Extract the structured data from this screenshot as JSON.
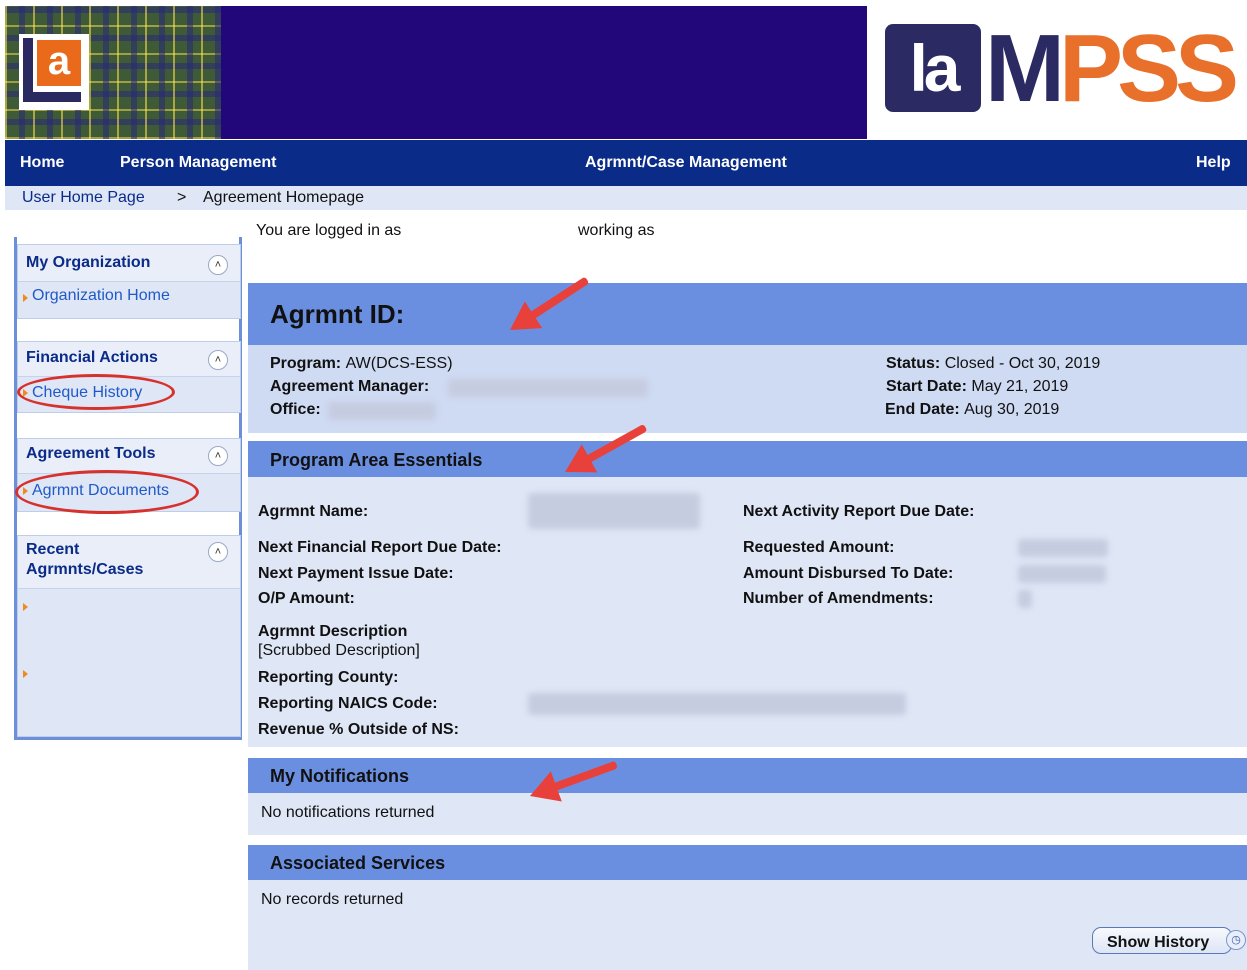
{
  "nav": {
    "home": "Home",
    "person_management": "Person Management",
    "agrmnt_case_management": "Agrmnt/Case Management",
    "help": "Help"
  },
  "breadcrumb": {
    "home": "User Home Page",
    "separator": ">",
    "current": "Agreement Homepage"
  },
  "sidebar": {
    "my_org": {
      "title": "My Organization",
      "links": [
        "Organization Home"
      ]
    },
    "financial": {
      "title": "Financial Actions",
      "links": [
        "Cheque History"
      ]
    },
    "tools": {
      "title": "Agreement Tools",
      "links": [
        "Agrmnt Documents"
      ]
    },
    "recent": {
      "title": "Recent Agrmnts/Cases"
    }
  },
  "login": {
    "logged_in_as": "You are logged in as",
    "working_as": "working as"
  },
  "agreement": {
    "id_label": "Agrmnt ID:",
    "program_label": "Program:",
    "program_value": "AW(DCS-ESS)",
    "manager_label": "Agreement Manager:",
    "office_label": "Office:",
    "status_label": "Status:",
    "status_value": "Closed - Oct 30, 2019",
    "start_label": "Start Date:",
    "start_value": "May 21, 2019",
    "end_label": "End Date:",
    "end_value": "Aug 30, 2019"
  },
  "essentials": {
    "title": "Program Area Essentials",
    "agrmnt_name": "Agrmnt Name:",
    "next_activity": "Next Activity Report Due Date:",
    "next_financial": "Next Financial Report Due Date:",
    "requested_amount": "Requested Amount:",
    "next_payment": "Next Payment Issue Date:",
    "amount_disbursed": "Amount Disbursed To Date:",
    "op_amount": "O/P Amount:",
    "num_amendments": "Number of Amendments:",
    "description_label": "Agrmnt Description",
    "description_value": "[Scrubbed Description]",
    "reporting_county": "Reporting County:",
    "reporting_naics": "Reporting NAICS Code:",
    "revenue_outside": "Revenue % Outside of NS:"
  },
  "notifications": {
    "title": "My Notifications",
    "empty": "No notifications returned"
  },
  "services": {
    "title": "Associated Services",
    "empty": "No records returned",
    "show_history": "Show History"
  },
  "colors": {
    "nav": "#0b2b88",
    "banner": "#22077a",
    "section_header": "#6b8fe0",
    "section_body": "#dfe6f5",
    "annotation": "#e8403a"
  },
  "branding": {
    "left_logo": "a",
    "right_logo": "LaMPSS"
  }
}
